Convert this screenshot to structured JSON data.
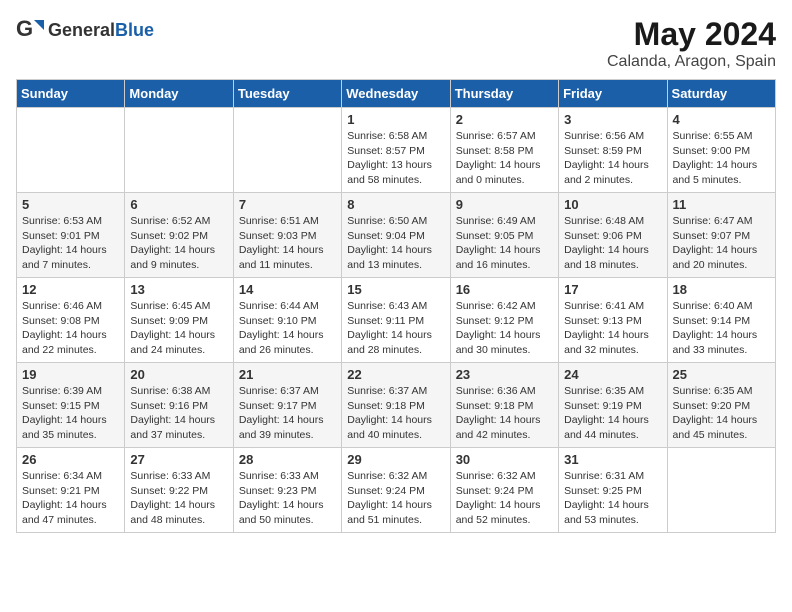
{
  "header": {
    "logo_general": "General",
    "logo_blue": "Blue",
    "month": "May 2024",
    "location": "Calanda, Aragon, Spain"
  },
  "days_of_week": [
    "Sunday",
    "Monday",
    "Tuesday",
    "Wednesday",
    "Thursday",
    "Friday",
    "Saturday"
  ],
  "weeks": [
    [
      {
        "day": "",
        "sunrise": "",
        "sunset": "",
        "daylight": ""
      },
      {
        "day": "",
        "sunrise": "",
        "sunset": "",
        "daylight": ""
      },
      {
        "day": "",
        "sunrise": "",
        "sunset": "",
        "daylight": ""
      },
      {
        "day": "1",
        "sunrise": "Sunrise: 6:58 AM",
        "sunset": "Sunset: 8:57 PM",
        "daylight": "Daylight: 13 hours and 58 minutes."
      },
      {
        "day": "2",
        "sunrise": "Sunrise: 6:57 AM",
        "sunset": "Sunset: 8:58 PM",
        "daylight": "Daylight: 14 hours and 0 minutes."
      },
      {
        "day": "3",
        "sunrise": "Sunrise: 6:56 AM",
        "sunset": "Sunset: 8:59 PM",
        "daylight": "Daylight: 14 hours and 2 minutes."
      },
      {
        "day": "4",
        "sunrise": "Sunrise: 6:55 AM",
        "sunset": "Sunset: 9:00 PM",
        "daylight": "Daylight: 14 hours and 5 minutes."
      }
    ],
    [
      {
        "day": "5",
        "sunrise": "Sunrise: 6:53 AM",
        "sunset": "Sunset: 9:01 PM",
        "daylight": "Daylight: 14 hours and 7 minutes."
      },
      {
        "day": "6",
        "sunrise": "Sunrise: 6:52 AM",
        "sunset": "Sunset: 9:02 PM",
        "daylight": "Daylight: 14 hours and 9 minutes."
      },
      {
        "day": "7",
        "sunrise": "Sunrise: 6:51 AM",
        "sunset": "Sunset: 9:03 PM",
        "daylight": "Daylight: 14 hours and 11 minutes."
      },
      {
        "day": "8",
        "sunrise": "Sunrise: 6:50 AM",
        "sunset": "Sunset: 9:04 PM",
        "daylight": "Daylight: 14 hours and 13 minutes."
      },
      {
        "day": "9",
        "sunrise": "Sunrise: 6:49 AM",
        "sunset": "Sunset: 9:05 PM",
        "daylight": "Daylight: 14 hours and 16 minutes."
      },
      {
        "day": "10",
        "sunrise": "Sunrise: 6:48 AM",
        "sunset": "Sunset: 9:06 PM",
        "daylight": "Daylight: 14 hours and 18 minutes."
      },
      {
        "day": "11",
        "sunrise": "Sunrise: 6:47 AM",
        "sunset": "Sunset: 9:07 PM",
        "daylight": "Daylight: 14 hours and 20 minutes."
      }
    ],
    [
      {
        "day": "12",
        "sunrise": "Sunrise: 6:46 AM",
        "sunset": "Sunset: 9:08 PM",
        "daylight": "Daylight: 14 hours and 22 minutes."
      },
      {
        "day": "13",
        "sunrise": "Sunrise: 6:45 AM",
        "sunset": "Sunset: 9:09 PM",
        "daylight": "Daylight: 14 hours and 24 minutes."
      },
      {
        "day": "14",
        "sunrise": "Sunrise: 6:44 AM",
        "sunset": "Sunset: 9:10 PM",
        "daylight": "Daylight: 14 hours and 26 minutes."
      },
      {
        "day": "15",
        "sunrise": "Sunrise: 6:43 AM",
        "sunset": "Sunset: 9:11 PM",
        "daylight": "Daylight: 14 hours and 28 minutes."
      },
      {
        "day": "16",
        "sunrise": "Sunrise: 6:42 AM",
        "sunset": "Sunset: 9:12 PM",
        "daylight": "Daylight: 14 hours and 30 minutes."
      },
      {
        "day": "17",
        "sunrise": "Sunrise: 6:41 AM",
        "sunset": "Sunset: 9:13 PM",
        "daylight": "Daylight: 14 hours and 32 minutes."
      },
      {
        "day": "18",
        "sunrise": "Sunrise: 6:40 AM",
        "sunset": "Sunset: 9:14 PM",
        "daylight": "Daylight: 14 hours and 33 minutes."
      }
    ],
    [
      {
        "day": "19",
        "sunrise": "Sunrise: 6:39 AM",
        "sunset": "Sunset: 9:15 PM",
        "daylight": "Daylight: 14 hours and 35 minutes."
      },
      {
        "day": "20",
        "sunrise": "Sunrise: 6:38 AM",
        "sunset": "Sunset: 9:16 PM",
        "daylight": "Daylight: 14 hours and 37 minutes."
      },
      {
        "day": "21",
        "sunrise": "Sunrise: 6:37 AM",
        "sunset": "Sunset: 9:17 PM",
        "daylight": "Daylight: 14 hours and 39 minutes."
      },
      {
        "day": "22",
        "sunrise": "Sunrise: 6:37 AM",
        "sunset": "Sunset: 9:18 PM",
        "daylight": "Daylight: 14 hours and 40 minutes."
      },
      {
        "day": "23",
        "sunrise": "Sunrise: 6:36 AM",
        "sunset": "Sunset: 9:18 PM",
        "daylight": "Daylight: 14 hours and 42 minutes."
      },
      {
        "day": "24",
        "sunrise": "Sunrise: 6:35 AM",
        "sunset": "Sunset: 9:19 PM",
        "daylight": "Daylight: 14 hours and 44 minutes."
      },
      {
        "day": "25",
        "sunrise": "Sunrise: 6:35 AM",
        "sunset": "Sunset: 9:20 PM",
        "daylight": "Daylight: 14 hours and 45 minutes."
      }
    ],
    [
      {
        "day": "26",
        "sunrise": "Sunrise: 6:34 AM",
        "sunset": "Sunset: 9:21 PM",
        "daylight": "Daylight: 14 hours and 47 minutes."
      },
      {
        "day": "27",
        "sunrise": "Sunrise: 6:33 AM",
        "sunset": "Sunset: 9:22 PM",
        "daylight": "Daylight: 14 hours and 48 minutes."
      },
      {
        "day": "28",
        "sunrise": "Sunrise: 6:33 AM",
        "sunset": "Sunset: 9:23 PM",
        "daylight": "Daylight: 14 hours and 50 minutes."
      },
      {
        "day": "29",
        "sunrise": "Sunrise: 6:32 AM",
        "sunset": "Sunset: 9:24 PM",
        "daylight": "Daylight: 14 hours and 51 minutes."
      },
      {
        "day": "30",
        "sunrise": "Sunrise: 6:32 AM",
        "sunset": "Sunset: 9:24 PM",
        "daylight": "Daylight: 14 hours and 52 minutes."
      },
      {
        "day": "31",
        "sunrise": "Sunrise: 6:31 AM",
        "sunset": "Sunset: 9:25 PM",
        "daylight": "Daylight: 14 hours and 53 minutes."
      },
      {
        "day": "",
        "sunrise": "",
        "sunset": "",
        "daylight": ""
      }
    ]
  ]
}
